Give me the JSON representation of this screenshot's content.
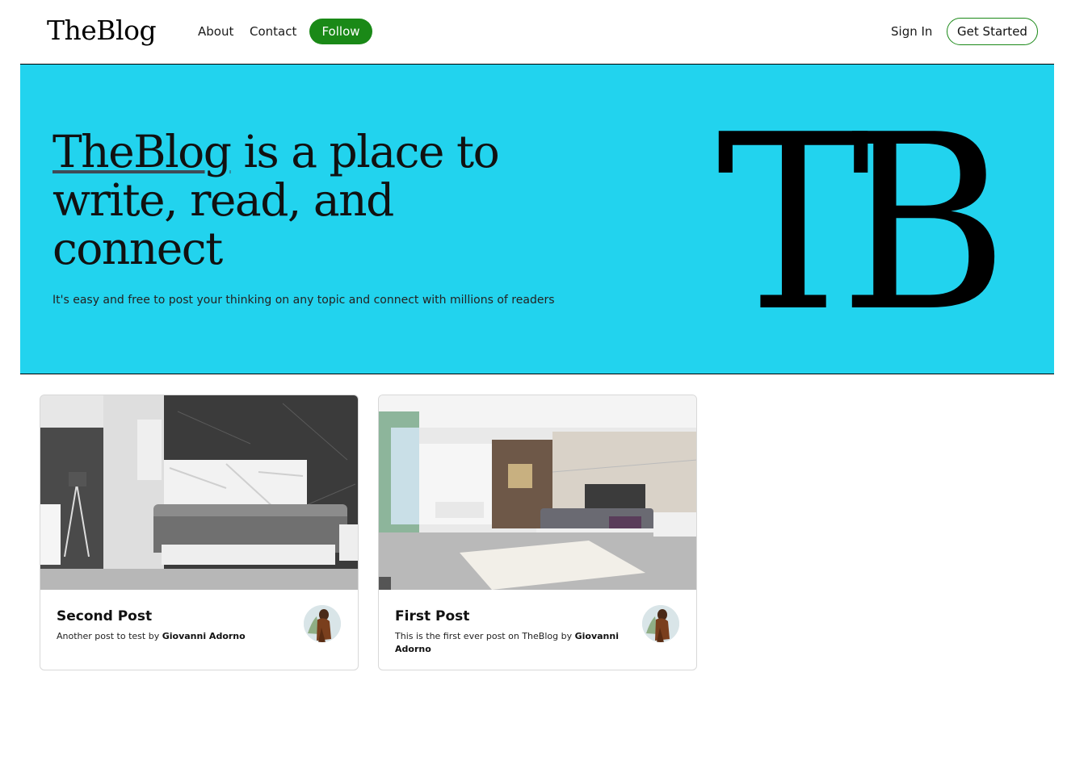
{
  "header": {
    "logo": "TheBlog",
    "nav": {
      "about": "About",
      "contact": "Contact",
      "follow": "Follow"
    },
    "sign_in": "Sign In",
    "get_started": "Get Started"
  },
  "hero": {
    "title_brand": "TheBlog",
    "title_rest": " is a place to write, read, and connect",
    "subtitle": "It's easy and free to post your thinking on any topic and connect with millions of readers",
    "mark": "TB"
  },
  "posts": [
    {
      "title": "Second Post",
      "description": "Another post to test",
      "by": "by",
      "author": "Giovanni Adorno",
      "image": "modern-bedroom-photo"
    },
    {
      "title": "First Post",
      "description": "This is the first ever post on TheBlog",
      "by": "by",
      "author": "Giovanni Adorno",
      "image": "open-plan-bedroom-photo"
    }
  ],
  "colors": {
    "accent_green": "#1a8917",
    "hero_bg": "#22d3ee"
  }
}
